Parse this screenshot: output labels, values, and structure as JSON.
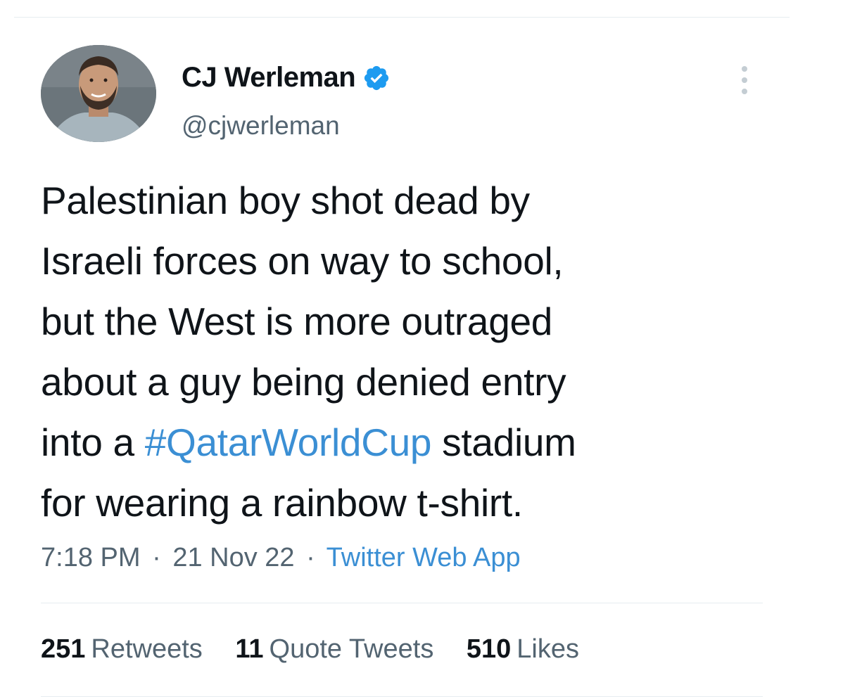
{
  "author": {
    "display_name": "CJ Werleman",
    "handle": "@cjwerleman",
    "verified": true,
    "avatar_icon": "profile-photo"
  },
  "tweet": {
    "lines": [
      "Palestinian boy shot dead by",
      "Israeli forces on way to school,",
      "but the West is more outraged",
      "about a guy being denied entry"
    ],
    "line5_prefix": "into a ",
    "hashtag": "#QatarWorldCup",
    "line5_suffix": " stadium",
    "line6": "for wearing a rainbow t-shirt."
  },
  "meta": {
    "time": "7:18 PM",
    "date": "21 Nov 22",
    "separator": "·",
    "source": "Twitter Web App"
  },
  "stats": {
    "retweets_count": "251",
    "retweets_label": "Retweets",
    "quotes_count": "11",
    "quotes_label": "Quote Tweets",
    "likes_count": "510",
    "likes_label": "Likes"
  },
  "colors": {
    "link": "#3b8fd4",
    "secondary_text": "#536471",
    "primary_text": "#0f1419",
    "verified_badge": "#1d9bf0"
  }
}
